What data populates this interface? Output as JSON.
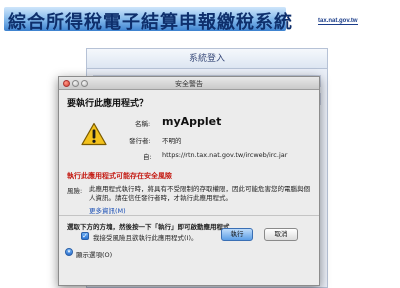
{
  "banner": {
    "title": "綜合所得稅電子結算申報繳稅系統",
    "logo_text": "tax.nat.gov.tw"
  },
  "background_panel": {
    "title": "系統登入"
  },
  "dialog": {
    "window_title": "安全警告",
    "question": "要執行此應用程式？",
    "icon": "warning-triangle-icon",
    "name_label": "名稱:",
    "app_name": "myApplet",
    "publisher_label": "發行者:",
    "publisher_value": "不明的",
    "from_label": "自:",
    "from_value": "https://rtn.tax.nat.gov.tw/ircweb/irc.jar",
    "risk_heading": "執行此應用程式可能存在安全風險",
    "risk_label": "風險:",
    "risk_text": "此應用程式執行時，將具有不受限制的存取權限，因此可能危害您的電腦與個人資訊。請在信任發行者時，才執行此應用程式。",
    "more_info": "更多資訊(M)",
    "instruction": "選取下方的方塊，然後按一下「執行」即可啟動應用程式",
    "accept_checked": true,
    "accept_label": "我接受風險且欲執行此應用程式(I)。",
    "run_button": "執行",
    "cancel_button": "取消",
    "show_details": "顯示選項(O)"
  },
  "colors": {
    "risk_red": "#c41a12",
    "link_blue": "#1a4fb5",
    "banner_text": "#0e2f6c"
  }
}
